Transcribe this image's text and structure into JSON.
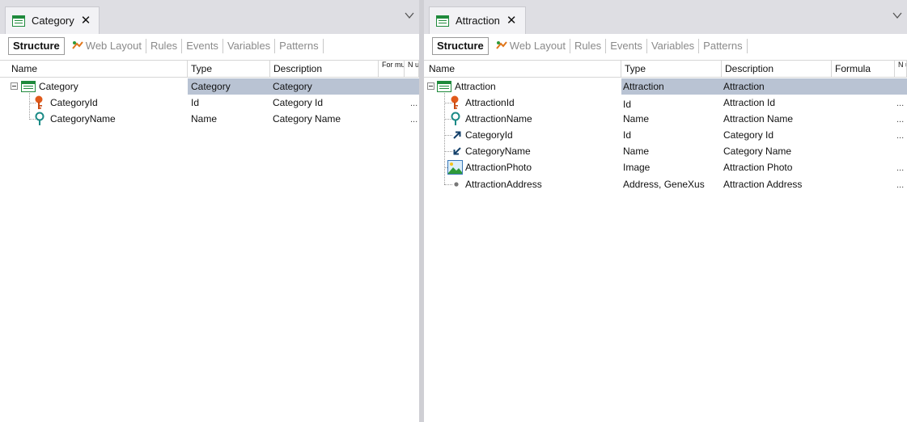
{
  "left": {
    "tab_title": "Category",
    "subtabs": [
      "Structure",
      "Web Layout",
      "Rules",
      "Events",
      "Variables",
      "Patterns"
    ],
    "columns": {
      "name": "Name",
      "type": "Type",
      "description": "Description",
      "formula": "For mula",
      "nullable": "N u"
    },
    "rows": [
      {
        "name": "Category",
        "type": "Category",
        "description": "Category",
        "dots": ""
      },
      {
        "name": "CategoryId",
        "type": "Id",
        "description": "Category Id",
        "dots": "..."
      },
      {
        "name": "CategoryName",
        "type": "Name",
        "description": "Category Name",
        "dots": "..."
      }
    ]
  },
  "right": {
    "tab_title": "Attraction",
    "subtabs": [
      "Structure",
      "Web Layout",
      "Rules",
      "Events",
      "Variables",
      "Patterns"
    ],
    "columns": {
      "name": "Name",
      "type": "Type",
      "description": "Description",
      "formula": "Formula",
      "nullable": "N u"
    },
    "rows": [
      {
        "name": "Attraction",
        "type": "Attraction",
        "description": "Attraction",
        "dots": ""
      },
      {
        "name": "AttractionId",
        "type": "Id",
        "description": "Attraction Id",
        "dots": "..."
      },
      {
        "name": "AttractionName",
        "type": "Name",
        "description": "Attraction Name",
        "dots": "..."
      },
      {
        "name": "CategoryId",
        "type": "Id",
        "description": "Category Id",
        "dots": "..."
      },
      {
        "name": "CategoryName",
        "type": "Name",
        "description": "Category Name",
        "dots": ""
      },
      {
        "name": "AttractionPhoto",
        "type": "Image",
        "description": "Attraction Photo",
        "dots": "..."
      },
      {
        "name": "AttractionAddress",
        "type": "Address, GeneXus",
        "description": "Attraction Address",
        "dots": "..."
      }
    ]
  },
  "icons": {
    "transaction": "transaction-icon",
    "primary_key": "primary-key-icon",
    "description_attribute": "description-attribute-icon",
    "foreign_key": "foreign-key-icon",
    "inferred_attribute": "inferred-attribute-icon",
    "image_attribute": "image-attribute-icon",
    "attribute": "attribute-dot-icon",
    "web_layout": "web-layout-icon",
    "close": "close-icon",
    "chevron": "chevron-down-icon"
  },
  "colors": {
    "selected_row": "#b9c3d3",
    "transaction_green": "#1f8a3c",
    "key_orange": "#e05a1a",
    "desc_teal": "#1a8a86",
    "tab_strip": "#dedee3"
  }
}
